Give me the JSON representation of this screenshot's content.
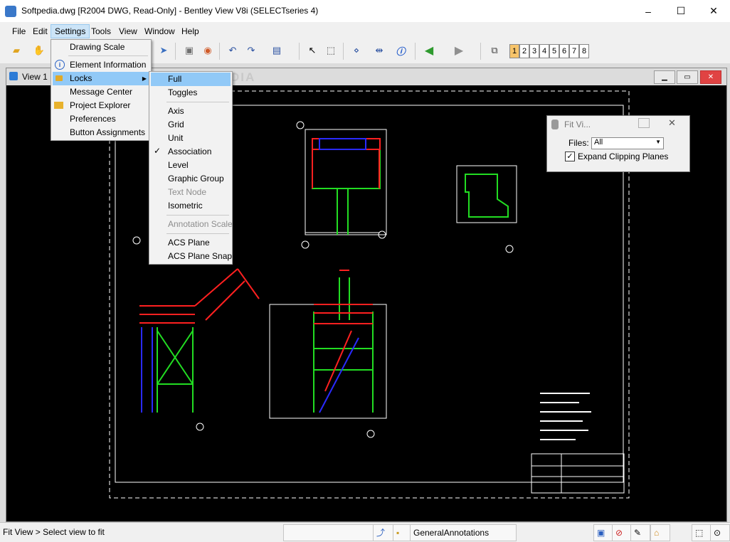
{
  "window": {
    "title": "Softpedia.dwg [R2004 DWG, Read-Only] - Bentley View V8i (SELECTseries 4)",
    "minimize": "–",
    "maximize": "☐",
    "close": "✕"
  },
  "menubar": {
    "items": [
      "File",
      "Edit",
      "Settings",
      "Tools",
      "View",
      "Window",
      "Help"
    ]
  },
  "toolbar": {
    "view_numbers": [
      "1",
      "2",
      "3",
      "4",
      "5",
      "6",
      "7",
      "8"
    ],
    "active_view": "1"
  },
  "view_window": {
    "title": "View 1"
  },
  "settings_menu": {
    "items": [
      "Drawing Scale",
      "Element Information",
      "Locks",
      "Message Center",
      "Project Explorer",
      "Preferences",
      "Button Assignments"
    ],
    "submenu_arrow": "▶"
  },
  "locks_menu": {
    "items": [
      "Full",
      "Toggles",
      "Axis",
      "Grid",
      "Unit",
      "Association",
      "Level",
      "Graphic Group",
      "Text Node",
      "Isometric",
      "Annotation Scale",
      "ACS Plane",
      "ACS Plane Snap"
    ],
    "checked": "Association",
    "check_mark": "✓"
  },
  "fit_dialog": {
    "title": "Fit Vi...",
    "files_label": "Files:",
    "files_value": "All",
    "expand_label": "Expand Clipping Planes",
    "expand_checked": true,
    "check_mark": "✓"
  },
  "watermark": "SOFTPEDIA",
  "status": {
    "prompt": "Fit View > Select view to fit",
    "level": "GeneralAnnotations"
  },
  "colors": {
    "accent": "#91c9f7",
    "cad_bg": "#000000",
    "cad_red": "#ff2020",
    "cad_green": "#22dd22",
    "cad_blue": "#2a2aff"
  }
}
